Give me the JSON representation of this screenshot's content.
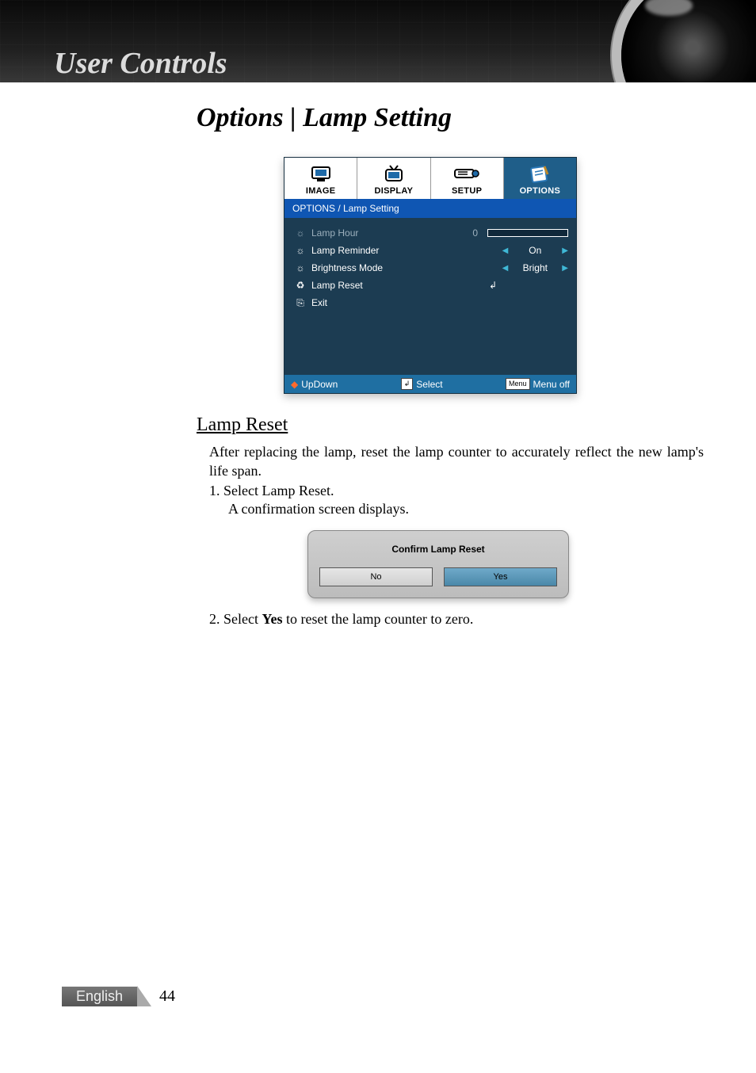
{
  "header": {
    "title": "User Controls"
  },
  "page": {
    "title": "Options | Lamp Setting",
    "section_title": "Lamp Reset",
    "intro": "After replacing the lamp, reset the lamp counter to accurately reflect the new lamp's life span.",
    "step1": "1. Select Lamp Reset.",
    "step1_sub": "A confirmation screen displays.",
    "step2_pre": "2. Select ",
    "step2_bold": "Yes",
    "step2_post": " to reset the lamp counter to zero."
  },
  "osd": {
    "tabs": [
      {
        "label": "IMAGE",
        "active": false
      },
      {
        "label": "DISPLAY",
        "active": false
      },
      {
        "label": "SETUP",
        "active": false
      },
      {
        "label": "OPTIONS",
        "active": true
      }
    ],
    "breadcrumb": "OPTIONS / Lamp Setting",
    "items": {
      "lamp_hour": {
        "label": "Lamp Hour",
        "value": "0"
      },
      "lamp_reminder": {
        "label": "Lamp Reminder",
        "value": "On"
      },
      "brightness_mode": {
        "label": "Brightness Mode",
        "value": "Bright"
      },
      "lamp_reset": {
        "label": "Lamp Reset"
      },
      "exit": {
        "label": "Exit"
      }
    },
    "footer": {
      "updown": "UpDown",
      "select": "Select",
      "menu_key": "Menu",
      "menu_off": "Menu off"
    }
  },
  "dialog": {
    "title": "Confirm Lamp Reset",
    "no": "No",
    "yes": "Yes"
  },
  "pagefoot": {
    "language": "English",
    "page_number": "44"
  }
}
